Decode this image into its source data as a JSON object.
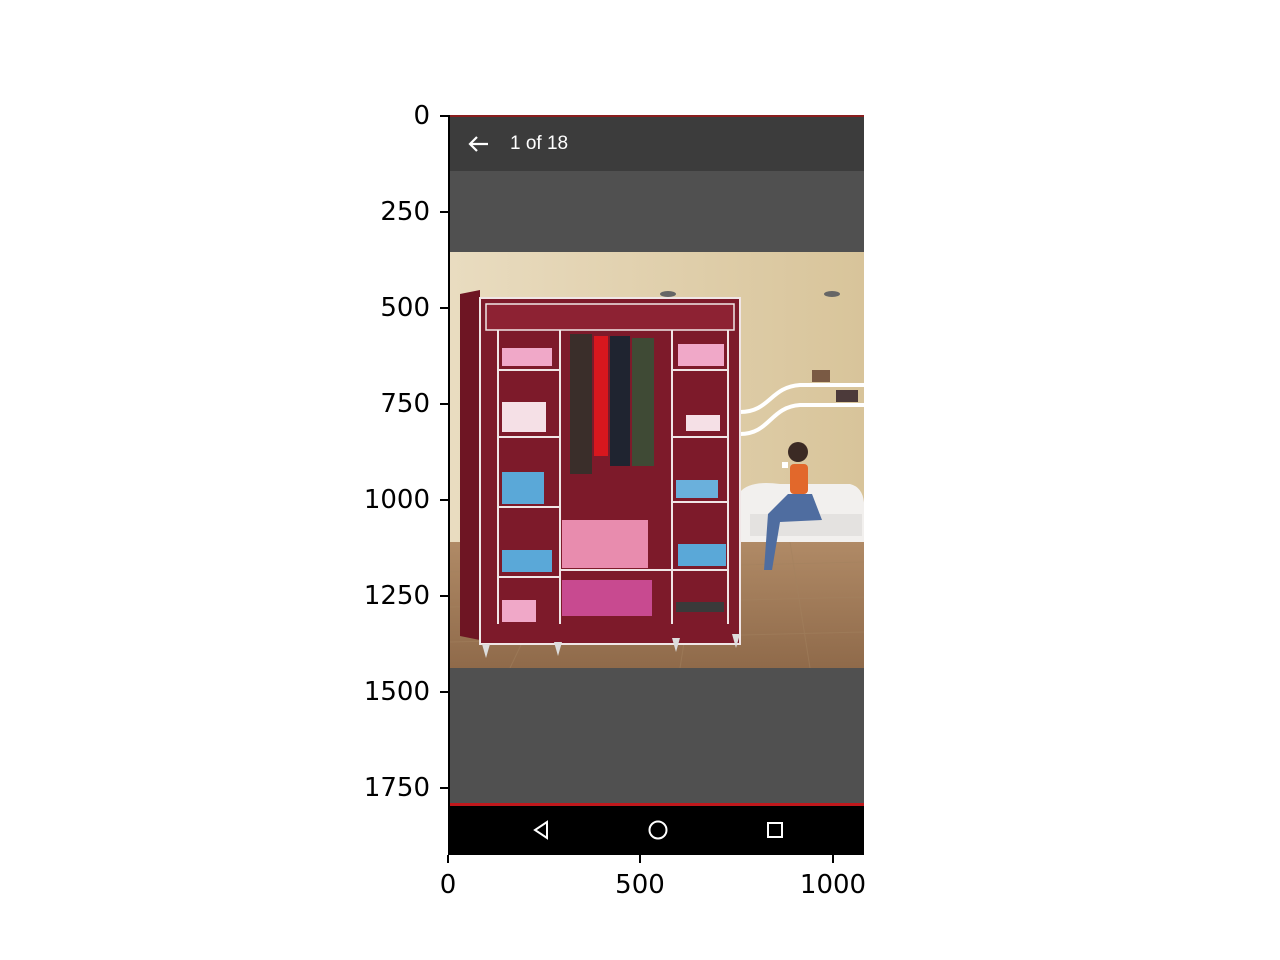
{
  "axis": {
    "y_ticks": [
      "0",
      "250",
      "500",
      "750",
      "1000",
      "1250",
      "1500",
      "1750"
    ],
    "x_ticks": [
      "0",
      "500",
      "1000"
    ]
  },
  "toolbar": {
    "back_icon": "arrow-left-icon",
    "counter": "1 of 18"
  },
  "photo": {
    "subject": "maroon fabric wardrobe with shelves and storage boxes, woman seated on white sofa"
  },
  "navbar": {
    "back_icon": "triangle-back-icon",
    "home_icon": "circle-home-icon",
    "recents_icon": "square-recents-icon"
  },
  "colors": {
    "toolbar_bg": "#3c3c3c",
    "screen_bg": "#505050",
    "navbar_bg": "#000000",
    "accent_red": "#c0181c"
  }
}
